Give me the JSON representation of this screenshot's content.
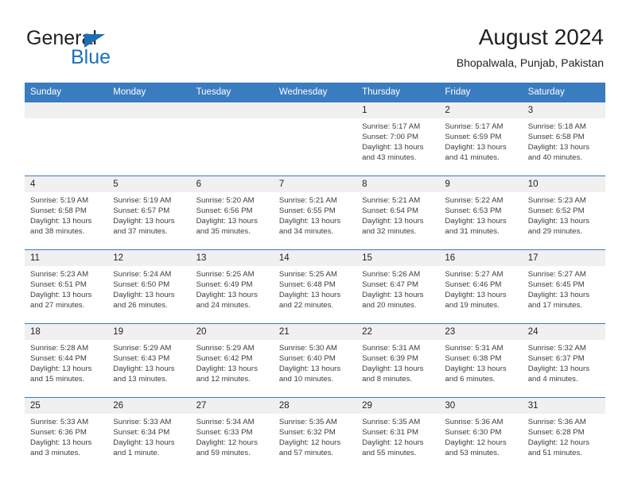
{
  "brand": {
    "name_part1": "General",
    "name_part2": "Blue",
    "triangle_color": "#1b6fb5"
  },
  "header": {
    "month_year": "August 2024",
    "location": "Bhopalwala, Punjab, Pakistan"
  },
  "theme": {
    "header_blue": "#3a7cc0",
    "daynum_band": "#f0f0f0",
    "text": "#231f20"
  },
  "weekday_headers": [
    "Sunday",
    "Monday",
    "Tuesday",
    "Wednesday",
    "Thursday",
    "Friday",
    "Saturday"
  ],
  "weeks": [
    {
      "days": [
        {
          "date": "",
          "lines": [
            "",
            "",
            "",
            ""
          ],
          "empty": true
        },
        {
          "date": "",
          "lines": [
            "",
            "",
            "",
            ""
          ],
          "empty": true
        },
        {
          "date": "",
          "lines": [
            "",
            "",
            "",
            ""
          ],
          "empty": true
        },
        {
          "date": "",
          "lines": [
            "",
            "",
            "",
            ""
          ],
          "empty": true
        },
        {
          "date": "1",
          "lines": [
            "Sunrise: 5:17 AM",
            "Sunset: 7:00 PM",
            "Daylight: 13 hours",
            "and 43 minutes."
          ]
        },
        {
          "date": "2",
          "lines": [
            "Sunrise: 5:17 AM",
            "Sunset: 6:59 PM",
            "Daylight: 13 hours",
            "and 41 minutes."
          ]
        },
        {
          "date": "3",
          "lines": [
            "Sunrise: 5:18 AM",
            "Sunset: 6:58 PM",
            "Daylight: 13 hours",
            "and 40 minutes."
          ]
        }
      ]
    },
    {
      "days": [
        {
          "date": "4",
          "lines": [
            "Sunrise: 5:19 AM",
            "Sunset: 6:58 PM",
            "Daylight: 13 hours",
            "and 38 minutes."
          ]
        },
        {
          "date": "5",
          "lines": [
            "Sunrise: 5:19 AM",
            "Sunset: 6:57 PM",
            "Daylight: 13 hours",
            "and 37 minutes."
          ]
        },
        {
          "date": "6",
          "lines": [
            "Sunrise: 5:20 AM",
            "Sunset: 6:56 PM",
            "Daylight: 13 hours",
            "and 35 minutes."
          ]
        },
        {
          "date": "7",
          "lines": [
            "Sunrise: 5:21 AM",
            "Sunset: 6:55 PM",
            "Daylight: 13 hours",
            "and 34 minutes."
          ]
        },
        {
          "date": "8",
          "lines": [
            "Sunrise: 5:21 AM",
            "Sunset: 6:54 PM",
            "Daylight: 13 hours",
            "and 32 minutes."
          ]
        },
        {
          "date": "9",
          "lines": [
            "Sunrise: 5:22 AM",
            "Sunset: 6:53 PM",
            "Daylight: 13 hours",
            "and 31 minutes."
          ]
        },
        {
          "date": "10",
          "lines": [
            "Sunrise: 5:23 AM",
            "Sunset: 6:52 PM",
            "Daylight: 13 hours",
            "and 29 minutes."
          ]
        }
      ]
    },
    {
      "days": [
        {
          "date": "11",
          "lines": [
            "Sunrise: 5:23 AM",
            "Sunset: 6:51 PM",
            "Daylight: 13 hours",
            "and 27 minutes."
          ]
        },
        {
          "date": "12",
          "lines": [
            "Sunrise: 5:24 AM",
            "Sunset: 6:50 PM",
            "Daylight: 13 hours",
            "and 26 minutes."
          ]
        },
        {
          "date": "13",
          "lines": [
            "Sunrise: 5:25 AM",
            "Sunset: 6:49 PM",
            "Daylight: 13 hours",
            "and 24 minutes."
          ]
        },
        {
          "date": "14",
          "lines": [
            "Sunrise: 5:25 AM",
            "Sunset: 6:48 PM",
            "Daylight: 13 hours",
            "and 22 minutes."
          ]
        },
        {
          "date": "15",
          "lines": [
            "Sunrise: 5:26 AM",
            "Sunset: 6:47 PM",
            "Daylight: 13 hours",
            "and 20 minutes."
          ]
        },
        {
          "date": "16",
          "lines": [
            "Sunrise: 5:27 AM",
            "Sunset: 6:46 PM",
            "Daylight: 13 hours",
            "and 19 minutes."
          ]
        },
        {
          "date": "17",
          "lines": [
            "Sunrise: 5:27 AM",
            "Sunset: 6:45 PM",
            "Daylight: 13 hours",
            "and 17 minutes."
          ]
        }
      ]
    },
    {
      "days": [
        {
          "date": "18",
          "lines": [
            "Sunrise: 5:28 AM",
            "Sunset: 6:44 PM",
            "Daylight: 13 hours",
            "and 15 minutes."
          ]
        },
        {
          "date": "19",
          "lines": [
            "Sunrise: 5:29 AM",
            "Sunset: 6:43 PM",
            "Daylight: 13 hours",
            "and 13 minutes."
          ]
        },
        {
          "date": "20",
          "lines": [
            "Sunrise: 5:29 AM",
            "Sunset: 6:42 PM",
            "Daylight: 13 hours",
            "and 12 minutes."
          ]
        },
        {
          "date": "21",
          "lines": [
            "Sunrise: 5:30 AM",
            "Sunset: 6:40 PM",
            "Daylight: 13 hours",
            "and 10 minutes."
          ]
        },
        {
          "date": "22",
          "lines": [
            "Sunrise: 5:31 AM",
            "Sunset: 6:39 PM",
            "Daylight: 13 hours",
            "and 8 minutes."
          ]
        },
        {
          "date": "23",
          "lines": [
            "Sunrise: 5:31 AM",
            "Sunset: 6:38 PM",
            "Daylight: 13 hours",
            "and 6 minutes."
          ]
        },
        {
          "date": "24",
          "lines": [
            "Sunrise: 5:32 AM",
            "Sunset: 6:37 PM",
            "Daylight: 13 hours",
            "and 4 minutes."
          ]
        }
      ]
    },
    {
      "days": [
        {
          "date": "25",
          "lines": [
            "Sunrise: 5:33 AM",
            "Sunset: 6:36 PM",
            "Daylight: 13 hours",
            "and 3 minutes."
          ]
        },
        {
          "date": "26",
          "lines": [
            "Sunrise: 5:33 AM",
            "Sunset: 6:34 PM",
            "Daylight: 13 hours",
            "and 1 minute."
          ]
        },
        {
          "date": "27",
          "lines": [
            "Sunrise: 5:34 AM",
            "Sunset: 6:33 PM",
            "Daylight: 12 hours",
            "and 59 minutes."
          ]
        },
        {
          "date": "28",
          "lines": [
            "Sunrise: 5:35 AM",
            "Sunset: 6:32 PM",
            "Daylight: 12 hours",
            "and 57 minutes."
          ]
        },
        {
          "date": "29",
          "lines": [
            "Sunrise: 5:35 AM",
            "Sunset: 6:31 PM",
            "Daylight: 12 hours",
            "and 55 minutes."
          ]
        },
        {
          "date": "30",
          "lines": [
            "Sunrise: 5:36 AM",
            "Sunset: 6:30 PM",
            "Daylight: 12 hours",
            "and 53 minutes."
          ]
        },
        {
          "date": "31",
          "lines": [
            "Sunrise: 5:36 AM",
            "Sunset: 6:28 PM",
            "Daylight: 12 hours",
            "and 51 minutes."
          ]
        }
      ]
    }
  ]
}
